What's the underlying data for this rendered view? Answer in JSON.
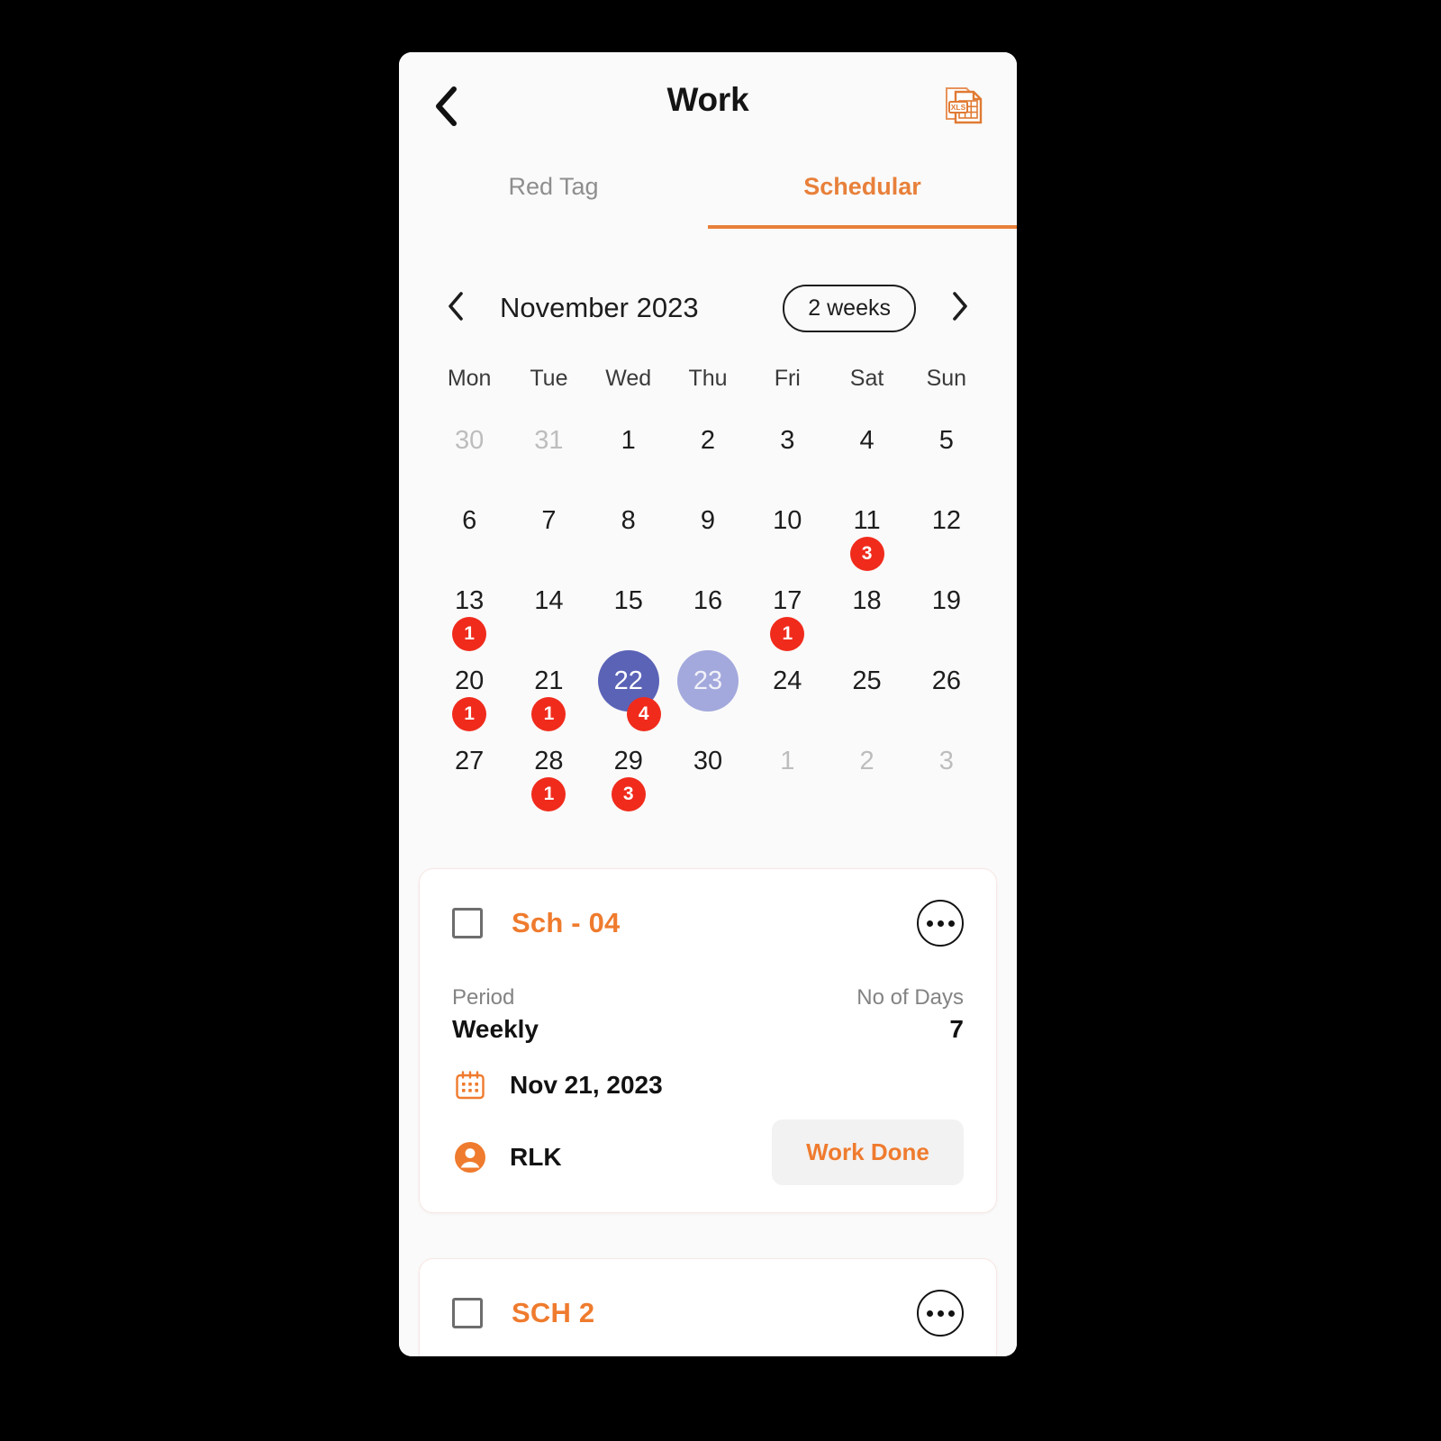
{
  "appbar": {
    "back_icon": "chevron-left-icon",
    "title": "Work",
    "export_icon": "xls-file-icon",
    "export_label": "XLS"
  },
  "tabs": [
    {
      "label": "Red Tag",
      "active": false
    },
    {
      "label": "Schedular",
      "active": true
    }
  ],
  "calendar": {
    "prev_icon": "chevron-left-icon",
    "next_icon": "chevron-right-icon",
    "month_label": "November 2023",
    "range_label": "2 weeks",
    "weekdays": [
      "Mon",
      "Tue",
      "Wed",
      "Thu",
      "Fri",
      "Sat",
      "Sun"
    ],
    "weeks": [
      [
        {
          "day": "30",
          "muted": true
        },
        {
          "day": "31",
          "muted": true
        },
        {
          "day": "1"
        },
        {
          "day": "2"
        },
        {
          "day": "3"
        },
        {
          "day": "4"
        },
        {
          "day": "5"
        }
      ],
      [
        {
          "day": "6"
        },
        {
          "day": "7"
        },
        {
          "day": "8"
        },
        {
          "day": "9"
        },
        {
          "day": "10"
        },
        {
          "day": "11",
          "badge": "3"
        },
        {
          "day": "12"
        }
      ],
      [
        {
          "day": "13",
          "badge": "1"
        },
        {
          "day": "14"
        },
        {
          "day": "15"
        },
        {
          "day": "16"
        },
        {
          "day": "17",
          "badge": "1"
        },
        {
          "day": "18"
        },
        {
          "day": "19"
        }
      ],
      [
        {
          "day": "20",
          "badge": "1"
        },
        {
          "day": "21",
          "badge": "1"
        },
        {
          "day": "22",
          "badge": "4",
          "badge_offset": true,
          "selected": true
        },
        {
          "day": "23",
          "today": true
        },
        {
          "day": "24"
        },
        {
          "day": "25"
        },
        {
          "day": "26"
        }
      ],
      [
        {
          "day": "27"
        },
        {
          "day": "28",
          "badge": "1"
        },
        {
          "day": "29",
          "badge": "3"
        },
        {
          "day": "30"
        },
        {
          "day": "1",
          "muted": true
        },
        {
          "day": "2",
          "muted": true
        },
        {
          "day": "3",
          "muted": true
        }
      ]
    ]
  },
  "cards": [
    {
      "title": "Sch - 04",
      "period_label": "Period",
      "period_value": "Weekly",
      "days_label": "No of Days",
      "days_value": "7",
      "date_icon": "calendar-icon",
      "date_value": "Nov 21, 2023",
      "person_icon": "person-icon",
      "person_value": "RLK",
      "action_label": "Work Done"
    },
    {
      "title": "SCH 2"
    }
  ],
  "colors": {
    "accent_orange": "#ef7b2e",
    "tab_orange": "#e8803a",
    "badge_red": "#f02b1c",
    "selected_blue": "#5b63b7",
    "today_blue": "#a3a9dc",
    "card_border": "#f7e7e4",
    "screen_bg": "#fafafa"
  }
}
